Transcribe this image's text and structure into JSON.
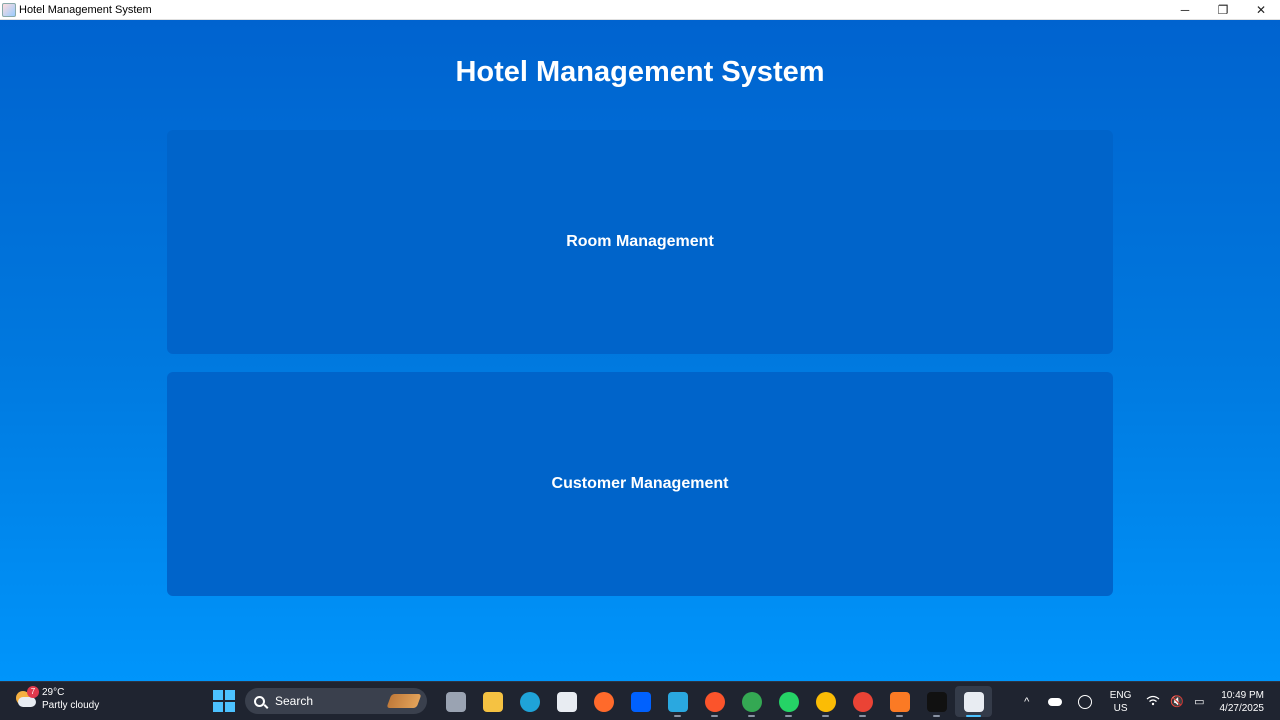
{
  "window": {
    "title": "Hotel Management System",
    "controls": {
      "minimize": "─",
      "restore": "❐",
      "close": "✕"
    }
  },
  "app": {
    "heading": "Hotel Management System",
    "buttons": [
      {
        "label": "Room Management"
      },
      {
        "label": "Customer Management"
      }
    ]
  },
  "taskbar": {
    "weather": {
      "temperature": "29°C",
      "condition": "Partly cloudy",
      "badge": "7"
    },
    "search_label": "Search",
    "apps": [
      {
        "icon": "task-view-icon",
        "color": "#9aa3b2"
      },
      {
        "icon": "file-explorer-icon",
        "color": "#f5c242"
      },
      {
        "icon": "edge-icon",
        "color": "#1fa3d8"
      },
      {
        "icon": "microsoft-store-icon",
        "color": "#e8ecf2"
      },
      {
        "icon": "firefox-icon",
        "color": "#ff6a2b"
      },
      {
        "icon": "dropbox-icon",
        "color": "#0061fe"
      },
      {
        "icon": "mouse-app-icon",
        "color": "#2aa8e0"
      },
      {
        "icon": "brave-icon",
        "color": "#fb542b"
      },
      {
        "icon": "chrome-icon",
        "color": "#34a853"
      },
      {
        "icon": "whatsapp-icon",
        "color": "#25d366"
      },
      {
        "icon": "chrome-profile-icon",
        "color": "#fbbc05"
      },
      {
        "icon": "chrome-alt-icon",
        "color": "#ea4335"
      },
      {
        "icon": "xampp-icon",
        "color": "#fb7a24"
      },
      {
        "icon": "terminal-icon",
        "color": "#111111"
      },
      {
        "icon": "java-icon",
        "color": "#e8ecf2"
      }
    ],
    "tray": {
      "chevron": "^",
      "language": "ENG",
      "region": "US",
      "wifi": "WiFi",
      "volume": "🔇",
      "battery": "▭",
      "time": "10:49 PM",
      "date": "4/27/2025"
    }
  }
}
